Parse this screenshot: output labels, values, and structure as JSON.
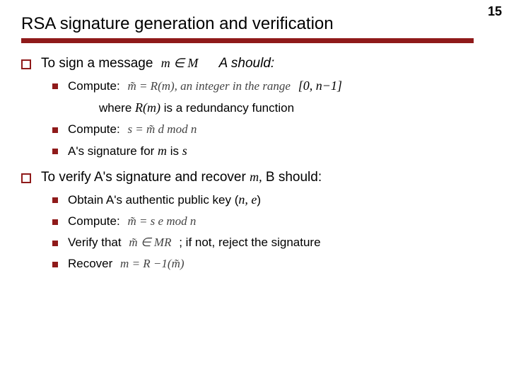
{
  "page_number": "15",
  "title": "RSA signature generation and verification",
  "sign": {
    "intro_prefix": "To sign a message",
    "intro_math": "m ∈ M",
    "intro_suffix": "A should:",
    "item1_label": "Compute:",
    "item1_formula": "m̃ = R(m), an integer in the range",
    "item1_range": "[0, n−1]",
    "item1_cont_prefix": "where ",
    "item1_cont_math": "R(m)",
    "item1_cont_suffix": " is a redundancy function",
    "item2_label": "Compute:",
    "item2_formula": "s = m̃ d mod n",
    "item3_prefix": "A's signature for ",
    "item3_m": "m",
    "item3_mid": " is ",
    "item3_s": "s"
  },
  "verify": {
    "intro_prefix": "To verify A's signature and recover ",
    "intro_m": "m,",
    "intro_suffix": " B should:",
    "item1_prefix": "Obtain A's authentic public key (",
    "item1_ne": "n, e",
    "item1_suffix": ")",
    "item2_label": "Compute:",
    "item2_formula": "m̃ = s e mod n",
    "item3_label": "Verify that",
    "item3_formula": "m̃ ∈ MR",
    "item3_suffix": "; if not, reject the signature",
    "item4_label": "Recover",
    "item4_formula": "m = R −1(m̃)"
  }
}
